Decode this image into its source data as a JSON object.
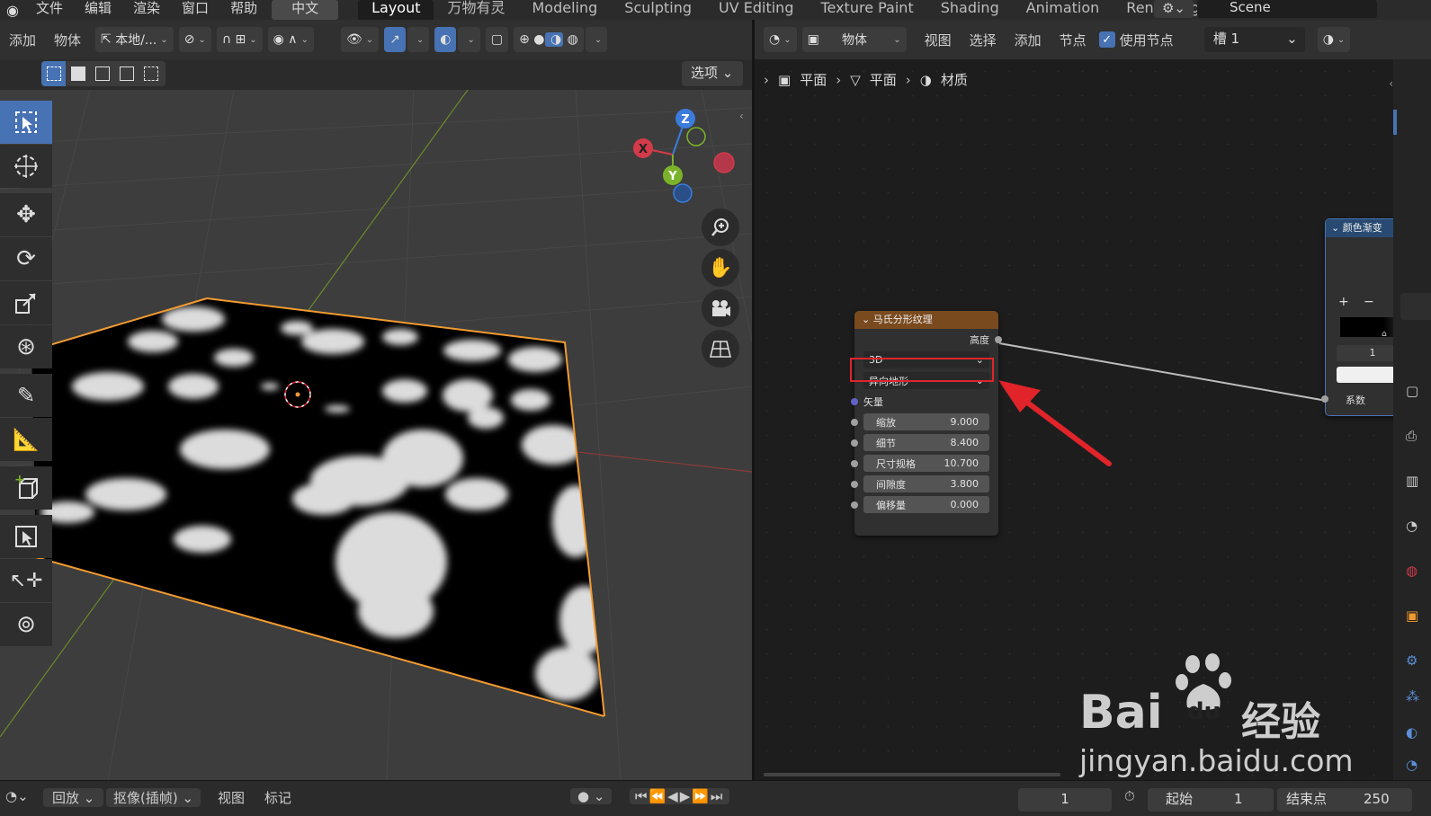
{
  "topbar": {
    "menus": [
      "文件",
      "编辑",
      "渲染",
      "窗口",
      "帮助"
    ],
    "language": "中文",
    "workspaces": [
      "Layout",
      "万物有灵",
      "Modeling",
      "Sculpting",
      "UV Editing",
      "Texture Paint",
      "Shading",
      "Animation",
      "Rendering"
    ],
    "active_workspace": "Layout",
    "scene": "Scene"
  },
  "viewport_header": {
    "add": "添加",
    "object": "物体",
    "orientation": "本地/...",
    "options": "选项"
  },
  "gizmo": {
    "z": "Z",
    "x": "X",
    "y": "Y"
  },
  "node_editor": {
    "header": {
      "mode": "物体",
      "view": "视图",
      "select": "选择",
      "add": "添加",
      "node": "节点",
      "use_nodes": "使用节点",
      "slot": "槽 1"
    },
    "breadcrumb": [
      "平面",
      "平面",
      "材质"
    ],
    "musgrave_node": {
      "title": "马氏分形纹理",
      "output": "高度",
      "dimensions": "3D",
      "type": "异向地形",
      "vector_input": "矢量",
      "fields": [
        {
          "label": "缩放",
          "value": "9.000"
        },
        {
          "label": "细节",
          "value": "8.400"
        },
        {
          "label": "尺寸规格",
          "value": "10.700"
        },
        {
          "label": "间隙度",
          "value": "3.800"
        },
        {
          "label": "偏移量",
          "value": "0.000"
        }
      ]
    },
    "color_ramp_node": {
      "title": "颜色渐变",
      "plus": "+",
      "minus": "−",
      "index": "1",
      "input": "系数"
    }
  },
  "timeline": {
    "playback": "回放",
    "keying": "抠像(插帧)",
    "view": "视图",
    "marker": "标记",
    "current_frame": "1",
    "start_label": "起始",
    "start": "1",
    "end_label": "结束点",
    "end": "250"
  },
  "watermark": {
    "brand": "Bai",
    "brand_du": "du",
    "brand_cn": "经验",
    "url": "jingyan.baidu.com"
  },
  "colors": {
    "accent": "#4772b3",
    "node_header": "#7a4a1f",
    "selection": "#f29b30",
    "annotation": "#e0242a"
  }
}
